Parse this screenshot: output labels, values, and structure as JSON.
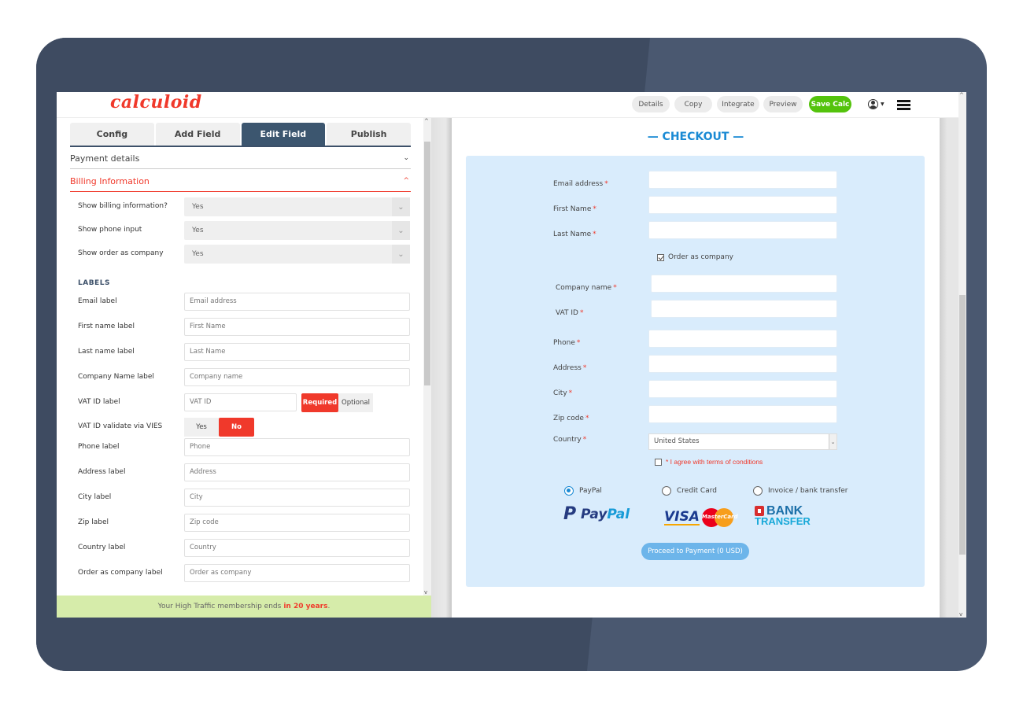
{
  "app": {
    "logo": "calculoid",
    "colors": {
      "brand": "#f0392b",
      "accent": "#3c566f",
      "save": "#54c30c",
      "checkout_blue": "#1a8ad4"
    }
  },
  "toolbar": {
    "buttons": [
      "Details",
      "Copy",
      "Integrate",
      "Preview"
    ],
    "save_label": "Save Calc",
    "user_icon": "user-circle-icon",
    "menu_icon": "hamburger-icon"
  },
  "editor": {
    "tabs": [
      {
        "label": "Config",
        "active": false
      },
      {
        "label": "Add Field",
        "active": false
      },
      {
        "label": "Edit Field",
        "active": true
      },
      {
        "label": "Publish",
        "active": false
      }
    ],
    "accordions": {
      "payment": "Payment details",
      "billing": "Billing Information"
    },
    "toggles": [
      {
        "label": "Show billing information?",
        "value": "Yes"
      },
      {
        "label": "Show phone input",
        "value": "Yes"
      },
      {
        "label": "Show order as company",
        "value": "Yes"
      }
    ],
    "labels_heading": "LABELS",
    "label_fields": [
      {
        "label": "Email label",
        "value": "Email address"
      },
      {
        "label": "First name label",
        "value": "First Name"
      },
      {
        "label": "Last name label",
        "value": "Last Name"
      },
      {
        "label": "Company Name label",
        "value": "Company name"
      }
    ],
    "vat": {
      "label": "VAT ID label",
      "value": "VAT ID",
      "options": [
        "Required",
        "Optional"
      ],
      "selected": "Required"
    },
    "vies": {
      "label": "VAT ID validate via VIES",
      "options": [
        "Yes",
        "No"
      ],
      "selected": "No"
    },
    "label_fields_2": [
      {
        "label": "Phone label",
        "value": "Phone"
      },
      {
        "label": "Address label",
        "value": "Address"
      },
      {
        "label": "City label",
        "value": "City"
      },
      {
        "label": "Zip label",
        "value": "Zip code"
      },
      {
        "label": "Country label",
        "value": "Country"
      },
      {
        "label": "Order as company label",
        "value": "Order as company"
      }
    ],
    "membership": {
      "text": "Your High Traffic membership ends",
      "highlight": "in 20 years",
      "suffix": "."
    }
  },
  "preview": {
    "title": "— CHECKOUT —",
    "fields_top": [
      {
        "label": "Email address",
        "required": "*"
      },
      {
        "label": "First Name",
        "required": "*"
      },
      {
        "label": "Last Name",
        "required": "*"
      }
    ],
    "order_as_company": {
      "label": "Order as company",
      "checked": true
    },
    "fields_company": [
      {
        "label": "Company name",
        "required": "*"
      },
      {
        "label": "VAT ID",
        "required": "*"
      }
    ],
    "fields_bottom": [
      {
        "label": "Phone",
        "required": "*"
      },
      {
        "label": "Address",
        "required": "*"
      },
      {
        "label": "City",
        "required": "*"
      },
      {
        "label": "Zip code",
        "required": "*"
      }
    ],
    "country": {
      "label": "Country",
      "required": "*",
      "value": "United States"
    },
    "terms": {
      "label": "* I agree with terms of conditions",
      "checked": false
    },
    "payment_options": [
      {
        "label": "PayPal",
        "selected": true
      },
      {
        "label": "Credit Card",
        "selected": false
      },
      {
        "label": "Invoice / bank transfer",
        "selected": false
      }
    ],
    "logos": {
      "paypal": {
        "pay": "Pay",
        "pal": "Pal"
      },
      "visa": "VISA",
      "mastercard": "MasterCard",
      "bank_line1": "BANK",
      "bank_line2": "TRANSFER"
    },
    "proceed_label": "Proceed to Payment (0 USD)"
  }
}
